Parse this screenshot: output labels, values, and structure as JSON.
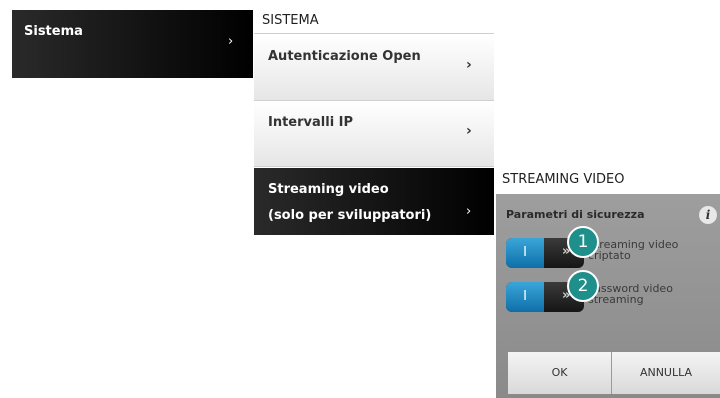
{
  "left_menu": {
    "label": "Sistema",
    "chevron": "›"
  },
  "sistema": {
    "header": "SISTEMA",
    "items": [
      {
        "label": "Autenticazione Open",
        "chevron": "›"
      },
      {
        "label": "Intervalli IP",
        "chevron": "›"
      },
      {
        "label_line1": "Streaming video",
        "label_line2": "(solo per sviluppatori)",
        "chevron": "›",
        "selected": true
      }
    ]
  },
  "panel": {
    "title": "STREAMING VIDEO",
    "heading": "Parametri di sicurezza",
    "info_icon": "i",
    "options": [
      {
        "badge": "1",
        "toggle_label": "I",
        "arrows": "»",
        "label_line1": "Streaming video",
        "label_line2": "criptato"
      },
      {
        "badge": "2",
        "toggle_label": "I",
        "arrows": "»",
        "label_line1": "Password video",
        "label_line2": "streaming"
      }
    ],
    "buttons": {
      "ok": "OK",
      "cancel": "ANNULLA"
    }
  },
  "colors": {
    "accent_blue": "#1f8fcc",
    "badge_teal": "#1e8f8a",
    "dark": "#000000"
  }
}
